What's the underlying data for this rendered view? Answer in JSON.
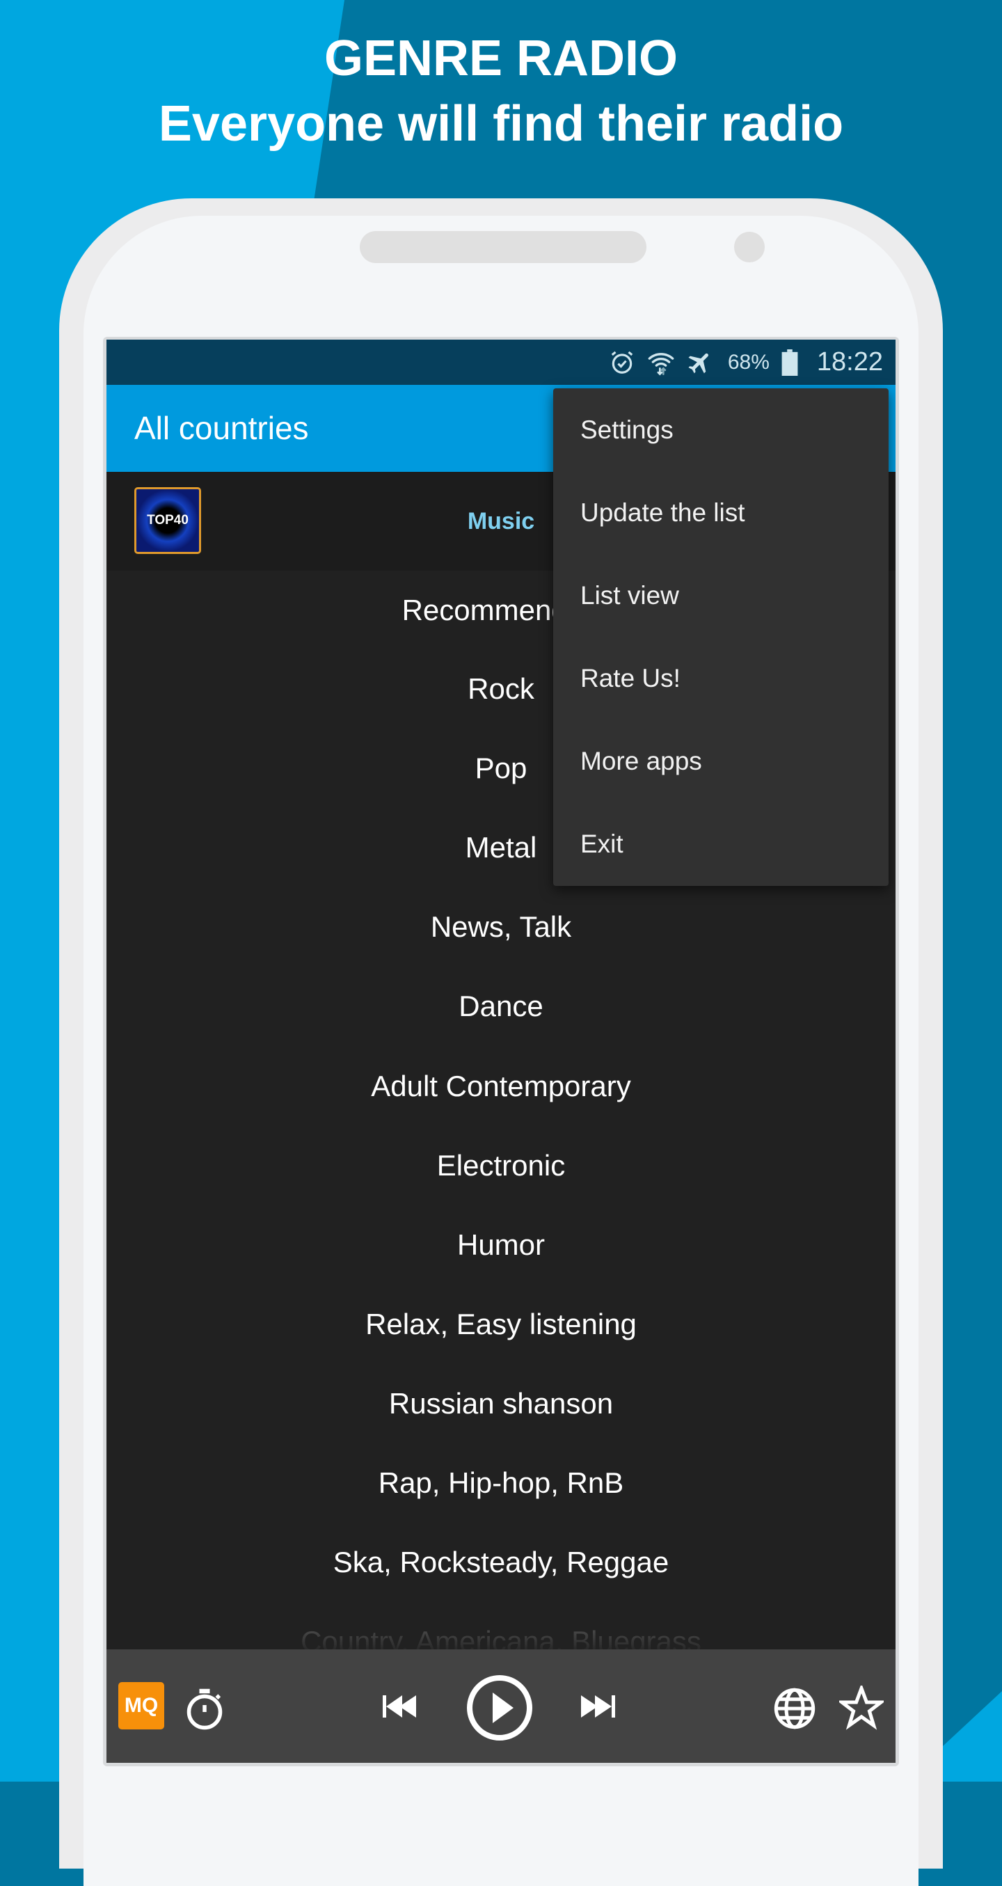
{
  "promo": {
    "line1": "GENRE RADIO",
    "line2": "Everyone will find their radio"
  },
  "colors": {
    "background_dark": "#0076a0",
    "background_light": "#00a7e0",
    "titlebar": "#009ade",
    "statusbar": "#063f5c",
    "list_bg": "#212121",
    "menu_bg": "#313131",
    "player_bg": "#434343",
    "mq_badge": "#f7900a",
    "category_accent": "#7fd0f0"
  },
  "status_bar": {
    "icons": [
      "alarm-icon",
      "wifi-icon",
      "airplane-mode-icon",
      "battery-icon"
    ],
    "battery_percent": "68%",
    "time": "18:22"
  },
  "app_bar": {
    "title": "All countries"
  },
  "now_playing_row": {
    "thumbnail_label": "TOP40",
    "category": "Music"
  },
  "genres": [
    "Recommended",
    "Rock",
    "Pop",
    "Metal",
    "News, Talk",
    "Dance",
    "Adult Contemporary",
    "Electronic",
    "Humor",
    "Relax, Easy listening",
    "Russian shanson",
    "Rap, Hip-hop, RnB",
    "Ska, Rocksteady, Reggae",
    "Country, Americana, Bluegrass"
  ],
  "overflow_menu": {
    "items": [
      "Settings",
      "Update the list",
      "List view",
      "Rate Us!",
      "More apps",
      "Exit"
    ]
  },
  "player": {
    "quality_badge": "MQ",
    "buttons": [
      "timer-icon",
      "previous-icon",
      "play-icon",
      "next-icon",
      "globe-icon",
      "star-icon"
    ]
  }
}
